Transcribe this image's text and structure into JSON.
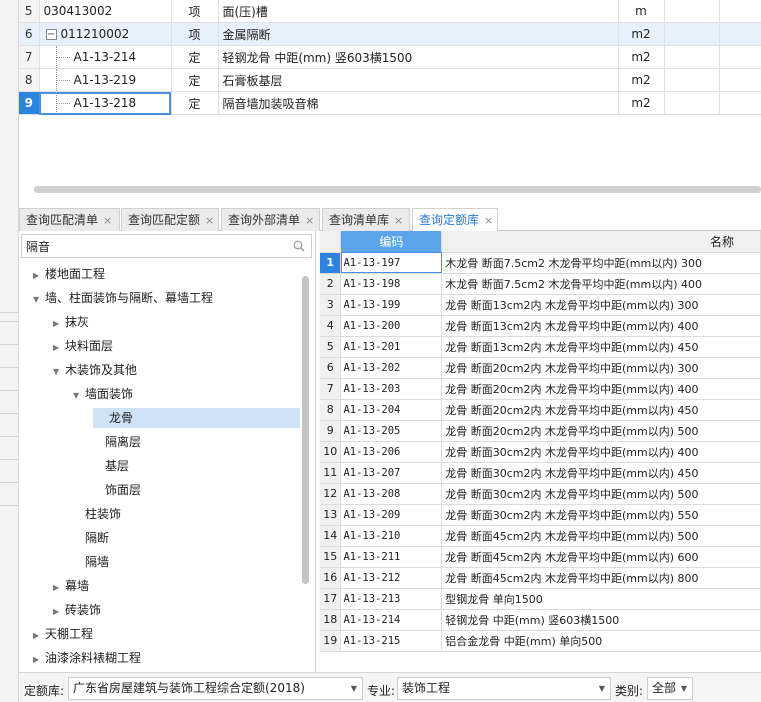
{
  "top_grid": {
    "rows": [
      {
        "num": "5",
        "code": "030413002",
        "type": "项",
        "name": "面(压)槽",
        "unit": "m",
        "level": 0,
        "highlight": false,
        "selected": false
      },
      {
        "num": "6",
        "code": "011210002",
        "type": "项",
        "name": "金属隔断",
        "unit": "m2",
        "level": 0,
        "highlight": true,
        "selected": false,
        "collapse": "−"
      },
      {
        "num": "7",
        "code": "A1-13-214",
        "type": "定",
        "name": "轻钢龙骨 中距(mm) 竖603横1500",
        "unit": "m2",
        "level": 1,
        "highlight": false,
        "selected": false
      },
      {
        "num": "8",
        "code": "A1-13-219",
        "type": "定",
        "name": "石膏板基层",
        "unit": "m2",
        "level": 1,
        "highlight": false,
        "selected": false
      },
      {
        "num": "9",
        "code": "A1-13-218",
        "type": "定",
        "name": "隔音墙加装吸音棉",
        "unit": "m2",
        "level": 1,
        "highlight": false,
        "selected": true
      }
    ]
  },
  "tabs": [
    {
      "label": "查询匹配清单",
      "close": "×",
      "active": false
    },
    {
      "label": "查询匹配定额",
      "close": "×",
      "active": false
    },
    {
      "label": "查询外部清单",
      "close": "×",
      "active": false
    },
    {
      "label": "查询清单库",
      "close": "×",
      "active": false
    },
    {
      "label": "查询定额库",
      "close": "×",
      "active": true
    }
  ],
  "search": {
    "value": "隔音"
  },
  "tree": [
    {
      "label": "楼地面工程",
      "level": 0,
      "arrow": "▶"
    },
    {
      "label": "墙、柱面装饰与隔断、幕墙工程",
      "level": 0,
      "arrow": "▼"
    },
    {
      "label": "抹灰",
      "level": 1,
      "arrow": "▶"
    },
    {
      "label": "块料面层",
      "level": 1,
      "arrow": "▶"
    },
    {
      "label": "木装饰及其他",
      "level": 1,
      "arrow": "▼"
    },
    {
      "label": "墙面装饰",
      "level": 2,
      "arrow": "▼"
    },
    {
      "label": "龙骨",
      "level": 3,
      "arrow": "",
      "selected": true
    },
    {
      "label": "隔离层",
      "level": 3,
      "arrow": ""
    },
    {
      "label": "基层",
      "level": 3,
      "arrow": ""
    },
    {
      "label": "饰面层",
      "level": 3,
      "arrow": ""
    },
    {
      "label": "柱装饰",
      "level": 2,
      "arrow": ""
    },
    {
      "label": "隔断",
      "level": 2,
      "arrow": ""
    },
    {
      "label": "隔墙",
      "level": 2,
      "arrow": ""
    },
    {
      "label": "幕墙",
      "level": 1,
      "arrow": "▶"
    },
    {
      "label": "砖装饰",
      "level": 1,
      "arrow": "▶"
    },
    {
      "label": "天棚工程",
      "level": 0,
      "arrow": "▶"
    },
    {
      "label": "油漆涂料裱糊工程",
      "level": 0,
      "arrow": "▶"
    }
  ],
  "list": {
    "headers": {
      "code": "编码",
      "name": "名称"
    },
    "rows": [
      {
        "num": "1",
        "code": "A1-13-197",
        "name": "木龙骨 断面7.5cm2 木龙骨平均中距(mm以内) 300"
      },
      {
        "num": "2",
        "code": "A1-13-198",
        "name": "木龙骨 断面7.5cm2 木龙骨平均中距(mm以内) 400"
      },
      {
        "num": "3",
        "code": "A1-13-199",
        "name": "龙骨 断面13cm2内 木龙骨平均中距(mm以内) 300"
      },
      {
        "num": "4",
        "code": "A1-13-200",
        "name": "龙骨 断面13cm2内 木龙骨平均中距(mm以内) 400"
      },
      {
        "num": "5",
        "code": "A1-13-201",
        "name": "龙骨 断面13cm2内 木龙骨平均中距(mm以内) 450"
      },
      {
        "num": "6",
        "code": "A1-13-202",
        "name": "龙骨 断面20cm2内 木龙骨平均中距(mm以内) 300"
      },
      {
        "num": "7",
        "code": "A1-13-203",
        "name": "龙骨 断面20cm2内 木龙骨平均中距(mm以内) 400"
      },
      {
        "num": "8",
        "code": "A1-13-204",
        "name": "龙骨 断面20cm2内 木龙骨平均中距(mm以内) 450"
      },
      {
        "num": "9",
        "code": "A1-13-205",
        "name": "龙骨 断面20cm2内 木龙骨平均中距(mm以内) 500"
      },
      {
        "num": "10",
        "code": "A1-13-206",
        "name": "龙骨 断面30cm2内 木龙骨平均中距(mm以内) 400"
      },
      {
        "num": "11",
        "code": "A1-13-207",
        "name": "龙骨 断面30cm2内 木龙骨平均中距(mm以内) 450"
      },
      {
        "num": "12",
        "code": "A1-13-208",
        "name": "龙骨 断面30cm2内 木龙骨平均中距(mm以内) 500"
      },
      {
        "num": "13",
        "code": "A1-13-209",
        "name": "龙骨 断面30cm2内 木龙骨平均中距(mm以内) 550"
      },
      {
        "num": "14",
        "code": "A1-13-210",
        "name": "龙骨 断面45cm2内 木龙骨平均中距(mm以内) 500"
      },
      {
        "num": "15",
        "code": "A1-13-211",
        "name": "龙骨 断面45cm2内 木龙骨平均中距(mm以内) 600"
      },
      {
        "num": "16",
        "code": "A1-13-212",
        "name": "龙骨 断面45cm2内 木龙骨平均中距(mm以内) 800"
      },
      {
        "num": "17",
        "code": "A1-13-213",
        "name": "型钢龙骨 单向1500"
      },
      {
        "num": "18",
        "code": "A1-13-214",
        "name": "轻钢龙骨 中距(mm) 竖603横1500"
      },
      {
        "num": "19",
        "code": "A1-13-215",
        "name": "铝合金龙骨 中距(mm) 单向500"
      }
    ]
  },
  "bottom": {
    "quota_label": "定额库:",
    "quota_value": "广东省房屋建筑与装饰工程综合定额(2018)",
    "major_label": "专业:",
    "major_value": "装饰工程",
    "category_label": "类别:",
    "category_value": "全部"
  },
  "icons": {
    "search": "search-icon",
    "dropdown": "chevron-down-icon",
    "close": "close-icon"
  },
  "colors": {
    "accent": "#2f83e0",
    "header_code": "#5aa4ea",
    "tree_selected": "#cfe3f7",
    "row_highlight": "#e7f1fb"
  }
}
